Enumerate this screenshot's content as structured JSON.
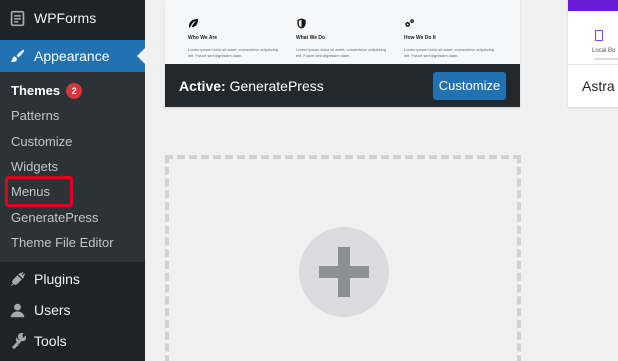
{
  "sidebar": {
    "menu_top": [
      {
        "label": "WPForms",
        "icon": "wpforms-icon"
      },
      {
        "label": "Appearance",
        "icon": "paintbrush-icon",
        "current": true
      }
    ],
    "submenu": [
      {
        "label": "Themes",
        "badge": "2",
        "current": true
      },
      {
        "label": "Patterns"
      },
      {
        "label": "Customize"
      },
      {
        "label": "Widgets"
      },
      {
        "label": "Menus",
        "highlighted": true
      },
      {
        "label": "GeneratePress"
      },
      {
        "label": "Theme File Editor"
      }
    ],
    "menu_bottom": [
      {
        "label": "Plugins",
        "icon": "plugin-icon"
      },
      {
        "label": "Users",
        "icon": "users-icon"
      },
      {
        "label": "Tools",
        "icon": "wrench-icon"
      }
    ]
  },
  "active_theme": {
    "prefix": "Active:",
    "name": "GeneratePress",
    "customize_label": "Customize",
    "preview_columns": [
      {
        "title": "Who We Are",
        "text": "Lorem ipsum dolor sit amet, consectetur adipiscing elit. Fusce sed dignissim diam."
      },
      {
        "title": "What We Do",
        "text": "Lorem ipsum dolor sit amet, consectetur adipiscing elit. Fusce sed dignissim diam."
      },
      {
        "title": "How We Do It",
        "text": "Lorem ipsum dolor sit amet, consectetur adipiscing elit. Fusce sed dignissim diam."
      }
    ]
  },
  "other_theme": {
    "name": "Astra",
    "preview_text": "Local Bu"
  },
  "colors": {
    "sidebar_bg": "#1d2327",
    "submenu_bg": "#2c3338",
    "accent": "#2271b1",
    "badge": "#d63638",
    "highlight": "#e0001b"
  }
}
